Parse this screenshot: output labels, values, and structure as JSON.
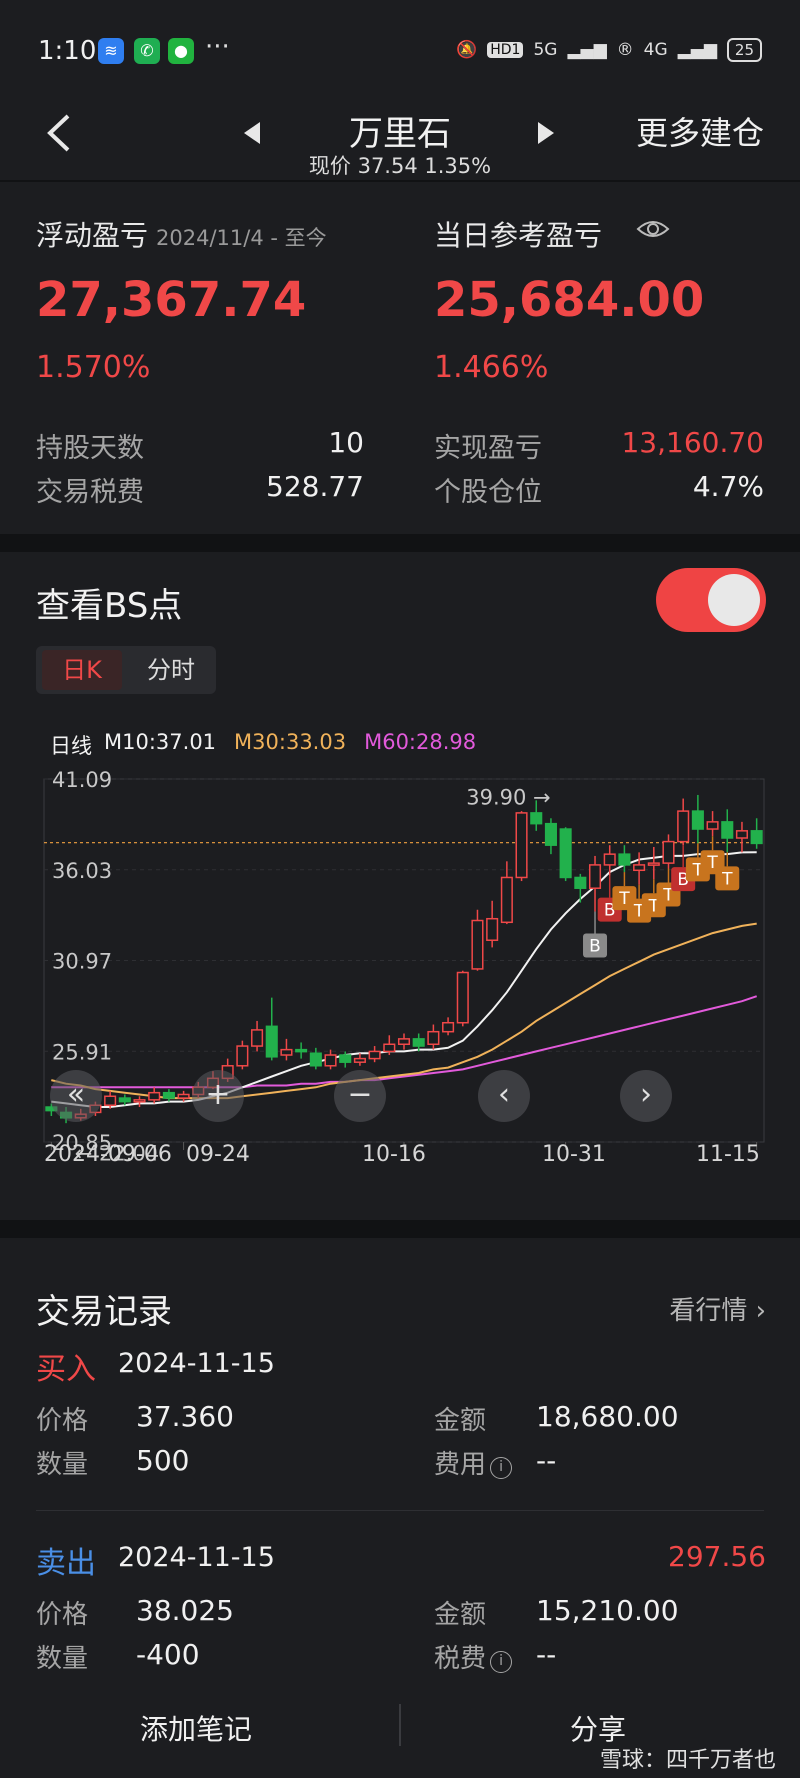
{
  "status": {
    "time": "1:10",
    "dots": "···",
    "signal_a": "HD1",
    "signal_b": "5G",
    "signal_c": "4G",
    "battery": "25"
  },
  "nav": {
    "title": "万里石",
    "subtitle": "现价 37.54 1.35%",
    "more": "更多建仓"
  },
  "pl": {
    "float_label": "浮动盈亏",
    "float_date": "2024/11/4 - 至今",
    "float_value": "27,367.74",
    "float_pct": "1.570%",
    "day_label": "当日参考盈亏",
    "day_value": "25,684.00",
    "day_pct": "1.466%",
    "days_label": "持股天数",
    "days_value": "10",
    "fee_label": "交易税费",
    "fee_value": "528.77",
    "real_label": "实现盈亏",
    "real_value": "13,160.70",
    "pos_label": "个股仓位",
    "pos_value": "4.7%"
  },
  "bs": {
    "title": "查看BS点",
    "tab_day": "日K",
    "tab_time": "分时",
    "legend": {
      "line": "日线",
      "m10": "M10:37.01",
      "m30": "M30:33.03",
      "m60": "M60:28.98"
    },
    "ctrl": {
      "back": "«",
      "zoom_in": "+",
      "zoom_out": "−",
      "prev": "‹",
      "next": "›"
    },
    "x_ticks": [
      "2024-09-06",
      "09-24",
      "10-16",
      "10-31",
      "11-15"
    ]
  },
  "chart_data": {
    "type": "candlestick",
    "y_ticks": [
      "41.09",
      "36.03",
      "30.97",
      "25.91",
      "20.85"
    ],
    "ylim": [
      20.85,
      41.09
    ],
    "current_price": 37.54,
    "max_label": "39.90",
    "min_label": "22.04",
    "candles": [
      [
        22.8,
        22.6,
        23.0,
        22.3
      ],
      [
        22.5,
        22.2,
        22.8,
        21.9
      ],
      [
        22.2,
        22.4,
        22.7,
        22.04
      ],
      [
        22.5,
        22.9,
        23.1,
        22.3
      ],
      [
        22.9,
        23.4,
        23.7,
        22.7
      ],
      [
        23.3,
        23.1,
        23.5,
        22.9
      ],
      [
        23.1,
        23.2,
        23.4,
        22.8
      ],
      [
        23.2,
        23.6,
        23.9,
        23.0
      ],
      [
        23.6,
        23.3,
        23.8,
        23.1
      ],
      [
        23.3,
        23.5,
        23.7,
        23.1
      ],
      [
        23.5,
        23.9,
        24.2,
        23.3
      ],
      [
        23.9,
        24.4,
        24.8,
        23.8
      ],
      [
        24.4,
        25.1,
        25.5,
        24.2
      ],
      [
        25.1,
        26.2,
        26.5,
        24.9
      ],
      [
        26.2,
        27.1,
        27.6,
        25.9
      ],
      [
        27.3,
        25.6,
        28.9,
        25.4
      ],
      [
        25.7,
        26.0,
        26.6,
        25.4
      ],
      [
        26.0,
        25.9,
        26.4,
        25.5
      ],
      [
        25.8,
        25.1,
        26.1,
        24.9
      ],
      [
        25.1,
        25.7,
        26.0,
        24.9
      ],
      [
        25.7,
        25.3,
        25.9,
        25.0
      ],
      [
        25.3,
        25.5,
        25.8,
        25.1
      ],
      [
        25.5,
        25.9,
        26.2,
        25.3
      ],
      [
        25.9,
        26.3,
        26.8,
        25.7
      ],
      [
        26.3,
        26.6,
        26.9,
        26.0
      ],
      [
        26.6,
        26.2,
        26.9,
        25.9
      ],
      [
        26.3,
        27.0,
        27.4,
        26.0
      ],
      [
        27.0,
        27.5,
        27.8,
        26.8
      ],
      [
        27.5,
        30.3,
        30.4,
        27.3
      ],
      [
        30.5,
        33.2,
        33.8,
        30.4
      ],
      [
        32.1,
        33.3,
        34.3,
        31.7
      ],
      [
        33.1,
        35.6,
        36.5,
        33.0
      ],
      [
        35.6,
        39.2,
        39.3,
        35.4
      ],
      [
        39.2,
        38.6,
        39.9,
        38.2
      ],
      [
        38.6,
        37.4,
        38.9,
        36.9
      ],
      [
        38.3,
        35.6,
        38.4,
        35.4
      ],
      [
        35.6,
        35.0,
        35.8,
        34.2
      ],
      [
        35.0,
        36.3,
        36.8,
        33.7
      ],
      [
        36.3,
        36.9,
        37.4,
        35.7
      ],
      [
        36.9,
        36.3,
        37.4,
        35.9
      ],
      [
        36.0,
        36.3,
        37.0,
        35.2
      ],
      [
        36.3,
        36.4,
        37.3,
        35.5
      ],
      [
        36.4,
        37.6,
        38.0,
        36.1
      ],
      [
        37.6,
        39.3,
        40.0,
        37.4
      ],
      [
        39.3,
        38.3,
        40.2,
        37.5
      ],
      [
        38.3,
        38.7,
        39.3,
        37.9
      ],
      [
        38.7,
        37.8,
        39.4,
        37.0
      ],
      [
        37.8,
        38.2,
        38.7,
        37.0
      ],
      [
        38.2,
        37.5,
        38.9,
        37.2
      ]
    ],
    "ma10": [
      23.1,
      23.0,
      22.9,
      22.8,
      22.8,
      22.9,
      23.0,
      23.0,
      23.1,
      23.1,
      23.2,
      23.4,
      23.6,
      23.9,
      24.2,
      24.5,
      24.8,
      25.1,
      25.3,
      25.5,
      25.7,
      25.8,
      25.8,
      25.9,
      25.9,
      26.0,
      26.0,
      26.1,
      26.5,
      27.3,
      28.2,
      29.2,
      30.4,
      31.6,
      32.7,
      33.6,
      34.4,
      35.1,
      35.9,
      36.3,
      36.6,
      36.7,
      36.8,
      36.8,
      36.9,
      36.9,
      36.9,
      37.0,
      37.01
    ],
    "ma30": [
      24.3,
      24.1,
      24.0,
      23.8,
      23.7,
      23.6,
      23.5,
      23.4,
      23.3,
      23.3,
      23.3,
      23.3,
      23.3,
      23.4,
      23.5,
      23.6,
      23.7,
      23.8,
      23.9,
      24.1,
      24.2,
      24.3,
      24.4,
      24.5,
      24.6,
      24.7,
      24.9,
      25.0,
      25.3,
      25.6,
      26.0,
      26.5,
      27.0,
      27.6,
      28.1,
      28.6,
      29.1,
      29.6,
      30.1,
      30.5,
      30.9,
      31.3,
      31.6,
      31.9,
      32.2,
      32.5,
      32.7,
      32.9,
      33.03
    ],
    "ma60": [
      23.9,
      23.9,
      23.9,
      23.9,
      23.9,
      23.9,
      23.9,
      23.9,
      23.9,
      23.9,
      23.9,
      23.9,
      23.9,
      23.9,
      24.0,
      24.0,
      24.0,
      24.1,
      24.1,
      24.2,
      24.2,
      24.3,
      24.3,
      24.4,
      24.5,
      24.6,
      24.7,
      24.8,
      24.9,
      25.1,
      25.3,
      25.5,
      25.7,
      25.9,
      26.1,
      26.3,
      26.5,
      26.7,
      26.9,
      27.1,
      27.3,
      27.5,
      27.7,
      27.9,
      28.1,
      28.3,
      28.5,
      28.7,
      28.98
    ],
    "markers": [
      {
        "label": "B",
        "type": "B-gray",
        "idx": 37
      },
      {
        "label": "B",
        "type": "B",
        "idx": 38
      },
      {
        "label": "T",
        "type": "T",
        "idx": 39
      },
      {
        "label": "T",
        "type": "T",
        "idx": 40
      },
      {
        "label": "T",
        "type": "T",
        "idx": 41
      },
      {
        "label": "T",
        "type": "T",
        "idx": 42
      },
      {
        "label": "B",
        "type": "B",
        "idx": 43
      },
      {
        "label": "T",
        "type": "T",
        "idx": 44
      },
      {
        "label": "T",
        "type": "T",
        "idx": 45
      },
      {
        "label": "T",
        "type": "T",
        "idx": 46
      }
    ]
  },
  "trades": {
    "title": "交易记录",
    "link": "看行情",
    "items": [
      {
        "type": "买入",
        "date": "2024-11-15",
        "profit": "",
        "price_label": "价格",
        "price": "37.360",
        "amount_label": "金额",
        "amount": "18,680.00",
        "qty_label": "数量",
        "qty": "500",
        "fee_label": "费用",
        "fee": "--"
      },
      {
        "type": "卖出",
        "date": "2024-11-15",
        "profit": "297.56",
        "price_label": "价格",
        "price": "38.025",
        "amount_label": "金额",
        "amount": "15,210.00",
        "qty_label": "数量",
        "qty": "-400",
        "fee_label": "税费",
        "fee": "--"
      }
    ],
    "add_note": "添加笔记",
    "share": "分享"
  },
  "watermark": "雪球：四千万者也"
}
